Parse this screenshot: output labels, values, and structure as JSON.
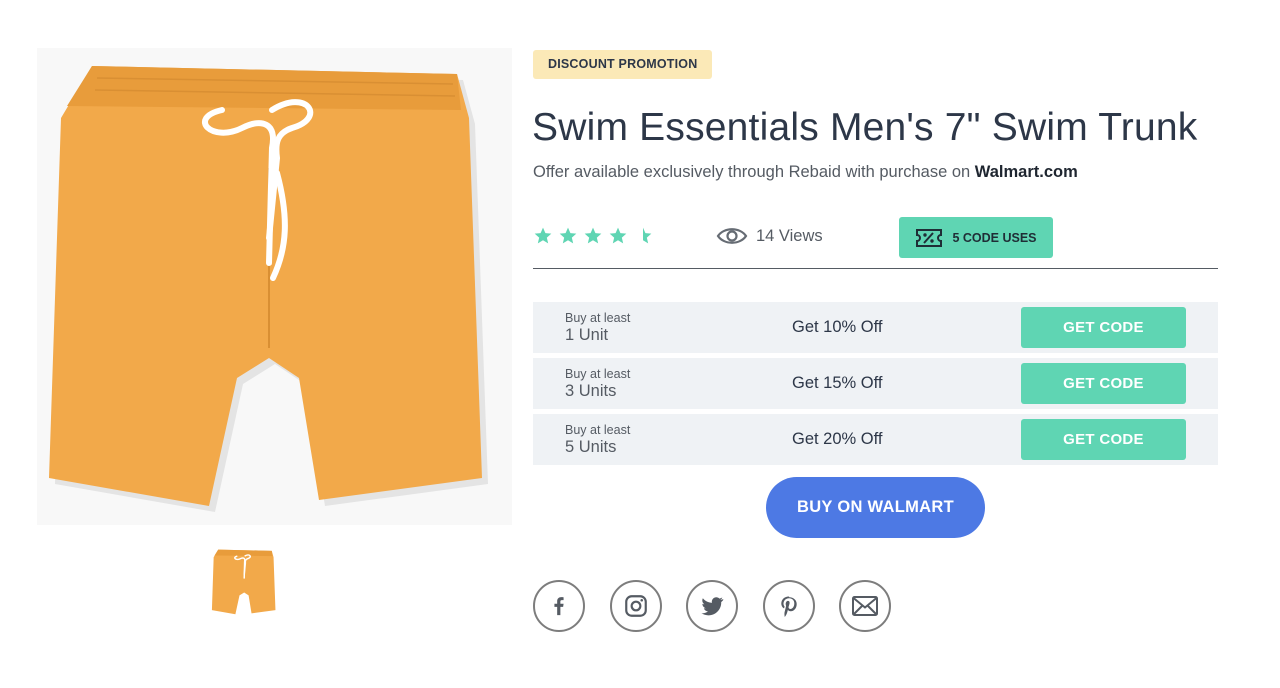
{
  "product": {
    "badge": "DISCOUNT PROMOTION",
    "title": "Swim Essentials Men's 7\" Swim Trunk",
    "subtitle_prefix": "Offer available exclusively through Rebaid with purchase on ",
    "retailer": "Walmart.com",
    "image_icon": "swim-trunk-image",
    "color": "#f2a94a"
  },
  "stats": {
    "rating": 4.5,
    "rating_max": 5,
    "views": "14 Views",
    "code_uses": "5 CODE USES"
  },
  "tiers": [
    {
      "min_label": "Buy at least",
      "qty": "1 Unit",
      "offer": "Get 10% Off",
      "button": "GET CODE"
    },
    {
      "min_label": "Buy at least",
      "qty": "3 Units",
      "offer": "Get 15% Off",
      "button": "GET CODE"
    },
    {
      "min_label": "Buy at least",
      "qty": "5 Units",
      "offer": "Get 20% Off",
      "button": "GET CODE"
    }
  ],
  "buy_button": "BUY ON WALMART",
  "social": [
    "facebook-icon",
    "instagram-icon",
    "twitter-icon",
    "pinterest-icon",
    "email-icon"
  ],
  "colors": {
    "accent_green": "#5fd5b3",
    "badge_yellow": "#fbe9b7",
    "buy_blue": "#4d79e4",
    "tier_bg": "#eff2f5",
    "text_dark": "#2d3748"
  }
}
